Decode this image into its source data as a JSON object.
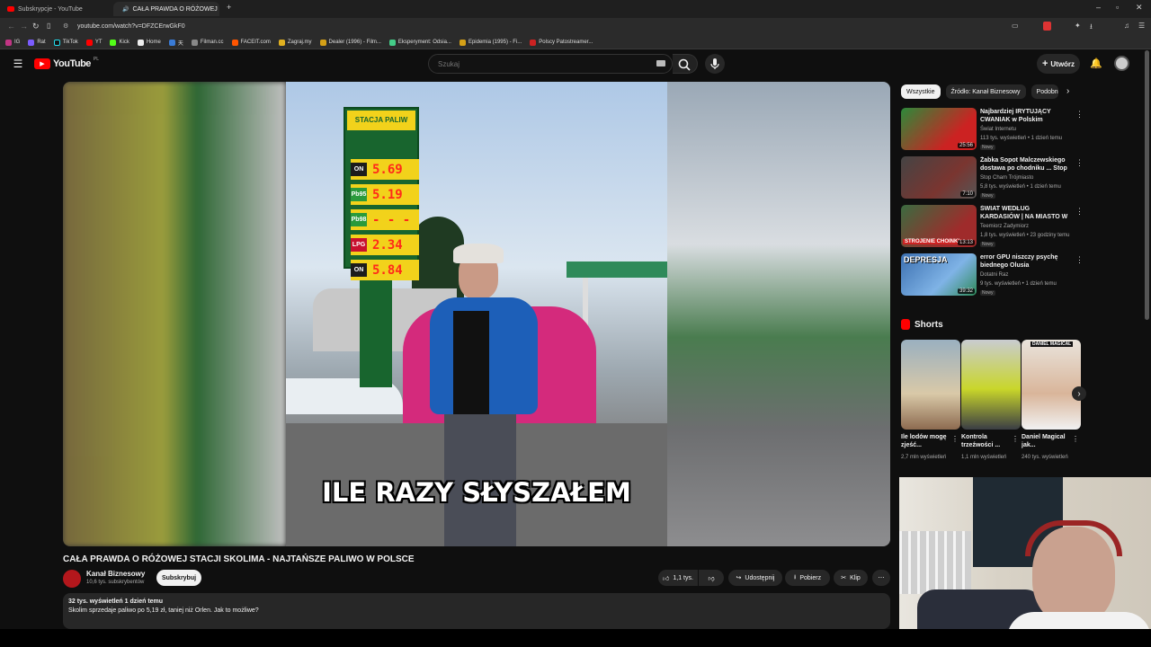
{
  "browser": {
    "tabs": [
      {
        "label": "Subskrypcje - YouTube",
        "active": false
      },
      {
        "label": "CAŁA PRAWDA O RÓŻOWEJ",
        "active": true
      }
    ],
    "url": "youtube.com/watch?v=DFZCErwGkF0",
    "bookmarks": [
      "IG",
      "Rat",
      "TikTok",
      "YT",
      "Kick",
      "Home",
      "天",
      "Filman.cc",
      "FACEIT.com",
      "Zagraj.my",
      "Dealer (1996) - Film...",
      "Eksperyment: Odsia...",
      "Epidemia (1995) - Fi...",
      "Polscy Patostreamer..."
    ]
  },
  "masthead": {
    "logo": "YouTube",
    "country": "PL",
    "search_placeholder": "Szukaj",
    "create_label": "Utwórz"
  },
  "video": {
    "caption": "ILE RAZY SŁYSZAŁEM",
    "sign_title": "STACJA PALIW",
    "prices": [
      {
        "fuel": "ON",
        "price": "5.69"
      },
      {
        "fuel": "Pb95",
        "price": "5.19"
      },
      {
        "fuel": "Pb98",
        "price": "- - -"
      },
      {
        "fuel": "LPG",
        "price": "2.34"
      },
      {
        "fuel": "ON",
        "price": "5.84"
      }
    ],
    "title": "CAŁA PRAWDA O RÓŻOWEJ STACJI SKOLIMA - NAJTAŃSZE PALIWO W POLSCE",
    "channel": "Kanał Biznesowy",
    "subscribers": "10,6 tys. subskrybentów",
    "subscribe_label": "Subskrybuj",
    "likes": "1,1 tys.",
    "share_label": "Udostępnij",
    "download_label": "Pobierz",
    "clip_label": "Klip",
    "desc_stats": "32 tys. wyświetleń  1 dzień temu",
    "desc_text": "Skolim sprzedaje paliwo po 5,19 zł, taniej niż Orlen. Jak to możliwe?"
  },
  "sidebar": {
    "chips": [
      "Wszystkie",
      "Źródło: Kanał Biznesowy",
      "Podobne"
    ],
    "recommendations": [
      {
        "title": "Najbardziej IRYTUJĄCY CWANIAK w Polskim Internecie",
        "channel": "Świat Internetu",
        "meta": "113 tys. wyświetleń • 1 dzień temu",
        "badge": "Nowy",
        "duration": "25:56",
        "color": "#2c8a3a"
      },
      {
        "title": "Żabka Sopot Malczewskiego dostawa po chodniku ... Stop ...",
        "channel": "Stop Cham Trójmiasto",
        "meta": "5,8 tys. wyświetleń • 1 dzień temu",
        "badge": "Nowy",
        "duration": "7:10",
        "color": "#7a3530"
      },
      {
        "title": "ŚWIAT WEDŁUG KARDASIÓW | NA MIASTO W SPODENKACH ...",
        "channel": "Teemiorz Zadymiorz",
        "meta": "1,8 tys. wyświetleń • 23 godziny temu",
        "badge": "Nowy",
        "duration": "13:13",
        "color": "#9f2b2b"
      },
      {
        "title": "error GPU niszczy psychę biednego Olusia",
        "channel": "Dotatni Raz",
        "meta": "9 tys. wyświetleń • 1 dzień temu",
        "badge": "Nowy",
        "duration": "39:32",
        "color": "#3b6fb0"
      }
    ],
    "shorts_label": "Shorts",
    "shorts": [
      {
        "title": "Ile lodów mogę zjeść...",
        "views": "2,7 mln wyświetleń"
      },
      {
        "title": "Kontrola trzeźwości ...",
        "views": "1,1 mln wyświetleń"
      },
      {
        "title": "Daniel Magical jak...",
        "views": "240 tys. wyświetleń"
      }
    ],
    "thumb_texts": {
      "rec3": "STROJENIE CHOINKI",
      "rec4": "DEPRESJA",
      "short3": "DANIEL MAGICAL"
    }
  },
  "colors": {
    "yt_red": "#ff0000",
    "sign_green": "#18652e",
    "price_red": "#ff2a1a"
  }
}
